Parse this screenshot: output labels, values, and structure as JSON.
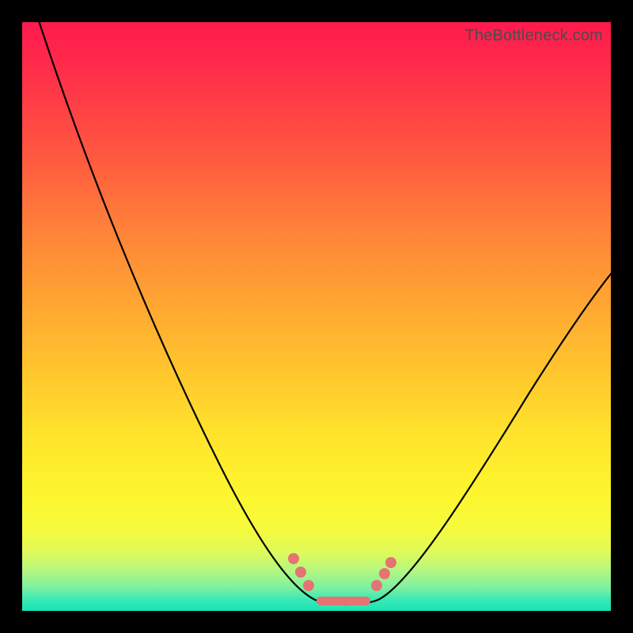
{
  "watermark": "TheBottleneck.com",
  "colors": {
    "frame": "#000000",
    "curve": "#000000",
    "marker": "#e57373",
    "gradient_top": "#ff1a4d",
    "gradient_mid": "#ffe32b",
    "gradient_bottom": "#16e4b7"
  },
  "chart_data": {
    "type": "line",
    "title": "",
    "xlabel": "",
    "ylabel": "",
    "xlim": [
      0,
      100
    ],
    "ylim": [
      0,
      100
    ],
    "series": [
      {
        "name": "bottleneck-curve",
        "x": [
          2,
          5,
          10,
          15,
          20,
          25,
          30,
          35,
          40,
          45,
          48,
          50,
          52,
          54,
          56,
          58,
          60,
          65,
          70,
          75,
          80,
          85,
          90,
          95,
          100
        ],
        "values": [
          100,
          90,
          76,
          63,
          52,
          42,
          33,
          25,
          18,
          11,
          7,
          4,
          2,
          1,
          1,
          1,
          2,
          5,
          10,
          16,
          22,
          29,
          36,
          43,
          50
        ]
      }
    ],
    "markers": [
      {
        "x": 46,
        "y": 9
      },
      {
        "x": 47,
        "y": 7
      },
      {
        "x": 49,
        "y": 4
      },
      {
        "x": 59,
        "y": 3
      },
      {
        "x": 61,
        "y": 5
      },
      {
        "x": 62,
        "y": 7
      }
    ],
    "flat_segment": {
      "x_start": 50,
      "x_end": 58,
      "y": 1
    }
  }
}
